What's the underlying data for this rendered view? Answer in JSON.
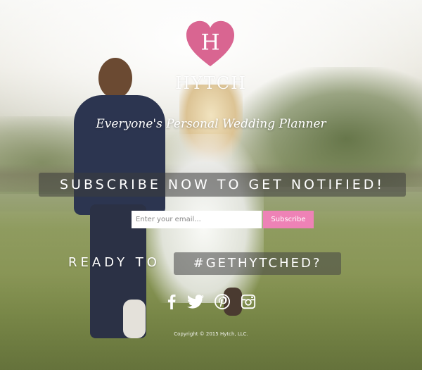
{
  "brand": {
    "logo_letter": "H",
    "name": "HYTCH",
    "tagline": "Everyone's Personal Wedding Planner",
    "logo_color": "#d96591"
  },
  "subscribe": {
    "banner_text": "SUBSCRIBE NOW TO GET NOTIFIED!",
    "email_placeholder": "Enter your email...",
    "email_value": "",
    "button_label": "Subscribe",
    "button_color": "#ee82b6"
  },
  "cta": {
    "ready_text": "READY TO",
    "hashtag": "#GETHYTCHED?"
  },
  "social": {
    "icons": [
      "facebook-icon",
      "twitter-icon",
      "pinterest-icon",
      "instagram-icon"
    ]
  },
  "footer": {
    "copyright": "Copyright © 2015 Hytch, LLC."
  }
}
